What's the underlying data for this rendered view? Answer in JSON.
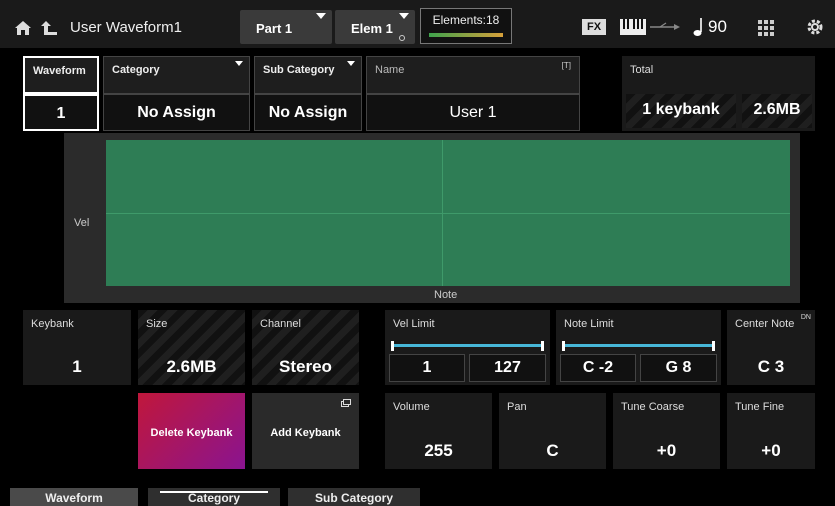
{
  "header": {
    "title": "User Waveform1",
    "part_label": "Part 1",
    "elem_label": "Elem 1",
    "elements_label": "Elements:18",
    "fx_label": "FX",
    "tempo": "90"
  },
  "fields": {
    "waveform": {
      "label": "Waveform",
      "value": "1"
    },
    "category": {
      "label": "Category",
      "value": "No Assign"
    },
    "sub_category": {
      "label": "Sub Category",
      "value": "No Assign"
    },
    "name": {
      "label": "Name",
      "value": "User 1",
      "badge": "[T]"
    },
    "total": {
      "label": "Total",
      "keybanks": "1 keybank",
      "size": "2.6MB"
    }
  },
  "graph": {
    "y_label": "Vel",
    "x_label": "Note",
    "fill_color": "#2e7d55"
  },
  "keybank": {
    "keybank": {
      "label": "Keybank",
      "value": "1"
    },
    "size": {
      "label": "Size",
      "value": "2.6MB"
    },
    "channel": {
      "label": "Channel",
      "value": "Stereo"
    },
    "vel_limit": {
      "label": "Vel Limit",
      "low": "1",
      "high": "127"
    },
    "note_limit": {
      "label": "Note Limit",
      "low": "C -2",
      "high": "G 8"
    },
    "center_note": {
      "label": "Center Note",
      "value": "C 3",
      "badge": "DN"
    },
    "volume": {
      "label": "Volume",
      "value": "255"
    },
    "pan": {
      "label": "Pan",
      "value": "C"
    },
    "tune_coarse": {
      "label": "Tune Coarse",
      "value": "+0"
    },
    "tune_fine": {
      "label": "Tune Fine",
      "value": "+0"
    }
  },
  "buttons": {
    "delete_keybank": "Delete Keybank",
    "add_keybank": "Add Keybank"
  },
  "bottom_tabs": [
    "Waveform",
    "Category",
    "Sub Category"
  ]
}
